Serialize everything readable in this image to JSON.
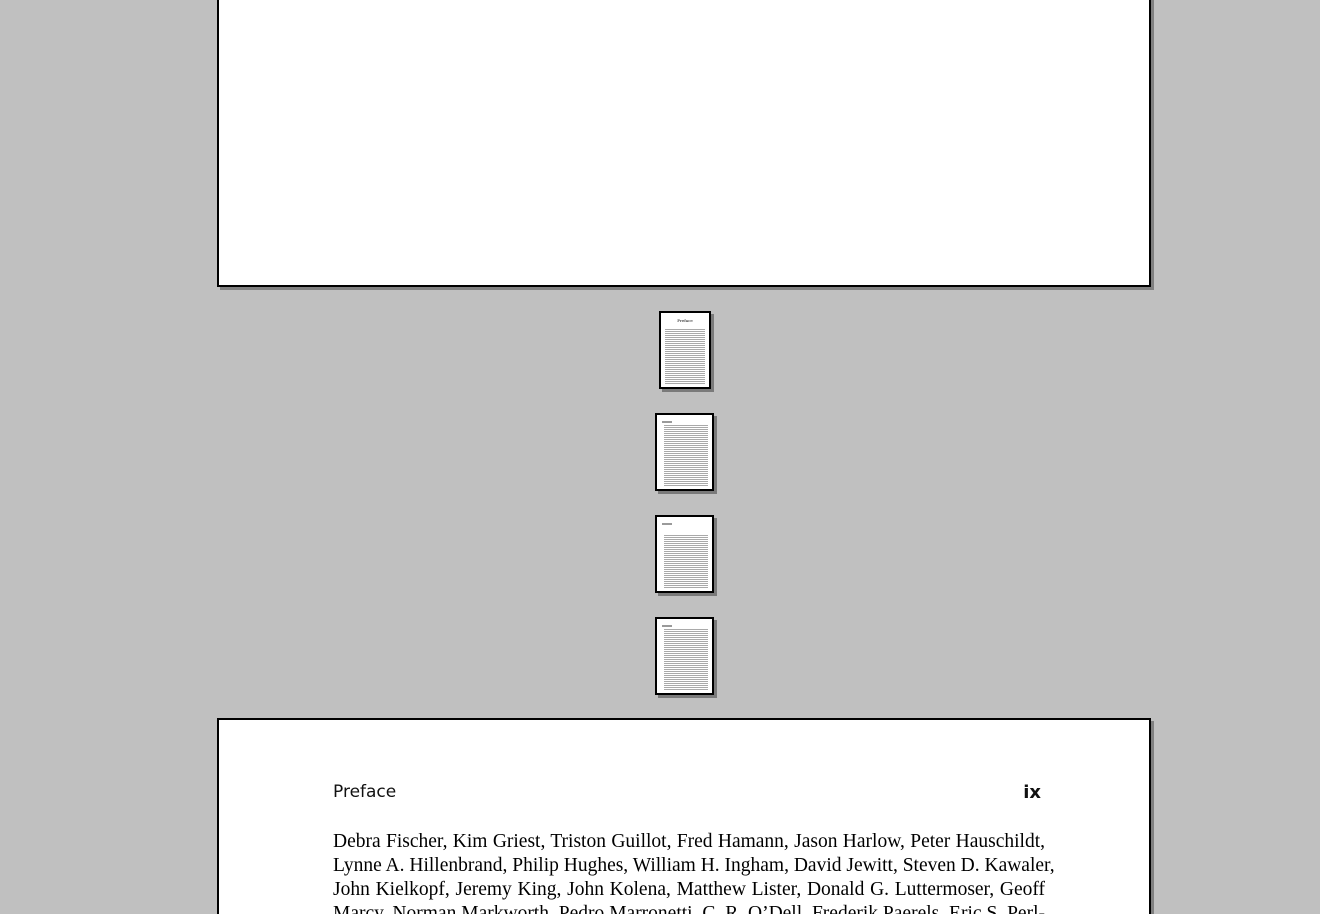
{
  "viewer": {
    "background": "#c0c0c0"
  },
  "thumbnails": [
    {
      "title": "Preface"
    },
    {
      "title": ""
    },
    {
      "title": ""
    },
    {
      "title": ""
    }
  ],
  "page": {
    "running_head_left": "Preface",
    "page_number": "ix",
    "lines": [
      "Debra Fischer, Kim Griest, Triston Guillot, Fred Hamann, Jason Harlow, Peter Hauschildt,",
      "Lynne A. Hillenbrand, Philip Hughes, William H. Ingham, David Jewitt, Steven D. Kawaler,",
      "John Kielkopf, Jeremy King, John Kolena, Matthew Lister, Donald G. Luttermoser, Geoff",
      "Marcy, Norman Markworth, Pedro Marronetti, C. R. O’Dell, Frederik Paerels, Eric S. Perl-"
    ]
  }
}
